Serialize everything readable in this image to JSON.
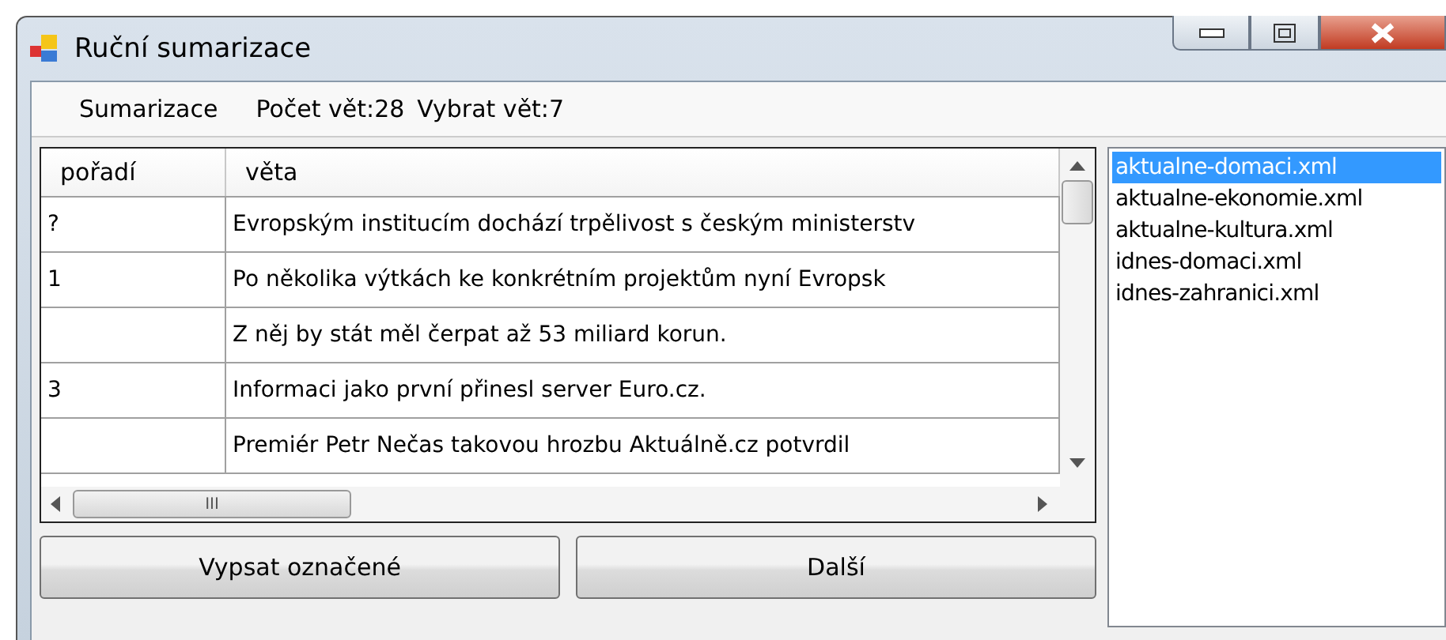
{
  "window": {
    "title": "Ruční sumarizace"
  },
  "menu": {
    "items": [
      "Sumarizace"
    ],
    "info": [
      "Počet vět:28",
      "Vybrat vět:7"
    ]
  },
  "table": {
    "columns": [
      "pořadí",
      "věta"
    ],
    "rows": [
      {
        "cells": [
          "?",
          "Evropským institucím dochází trpělivost s českým ministerstv"
        ]
      },
      {
        "cells": [
          "1",
          "Po několika výtkách ke konkrétním projektům nyní Evropsk"
        ]
      },
      {
        "cells": [
          "",
          "Z něj by stát měl čerpat až 53 miliard korun."
        ]
      },
      {
        "cells": [
          "3",
          "Informaci jako první přinesl server Euro.cz."
        ]
      },
      {
        "cells": [
          "",
          "Premiér Petr Nečas takovou hrozbu Aktuálně.cz potvrdil"
        ]
      }
    ],
    "hscroll_label": "III"
  },
  "files": [
    {
      "name": "aktualne-domaci.xml",
      "selected": true
    },
    {
      "name": "aktualne-ekonomie.xml",
      "selected": false
    },
    {
      "name": "aktualne-kultura.xml",
      "selected": false
    },
    {
      "name": "idnes-domaci.xml",
      "selected": false
    },
    {
      "name": "idnes-zahranici.xml",
      "selected": false
    }
  ],
  "buttons": [
    "Vypsat označené",
    "Další"
  ]
}
